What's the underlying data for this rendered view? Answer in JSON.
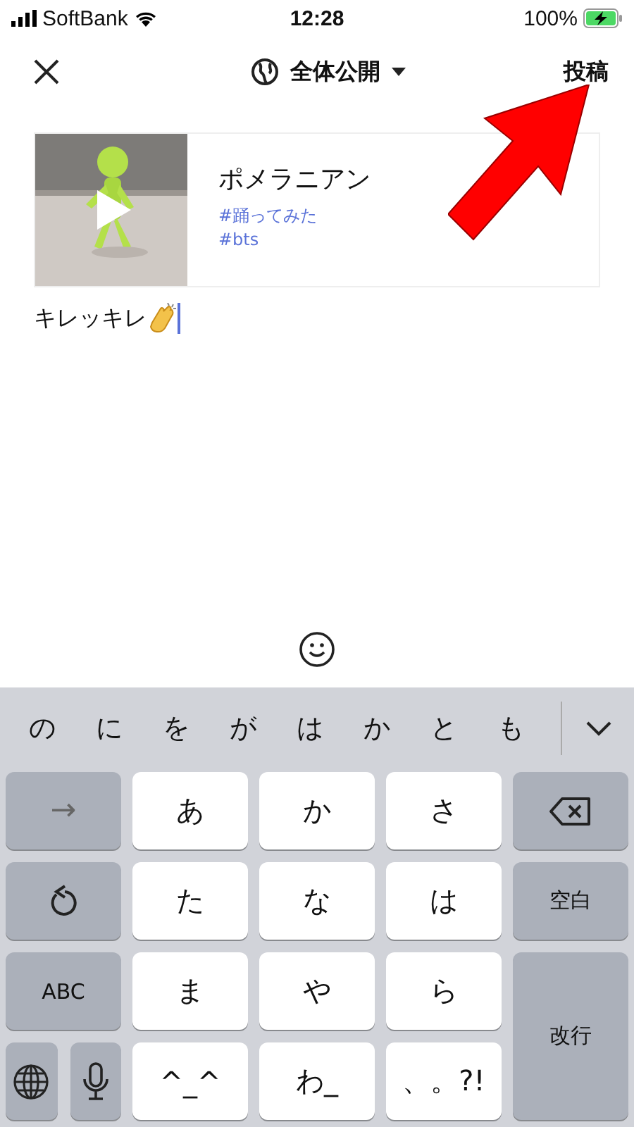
{
  "status_bar": {
    "carrier": "SoftBank",
    "time": "12:28",
    "battery": "100%"
  },
  "header": {
    "audience": "全体公開",
    "post": "投稿"
  },
  "video_card": {
    "title": "ポメラニアン",
    "tags": [
      "#踊ってみた",
      "#bts"
    ]
  },
  "comment": {
    "value": "キレッキレ"
  },
  "keyboard": {
    "candidates": [
      "の",
      "に",
      "を",
      "が",
      "は",
      "か",
      "と",
      "も"
    ],
    "keys": [
      {
        "label": "→",
        "kind": "function"
      },
      {
        "label": "あ",
        "kind": "letter"
      },
      {
        "label": "か",
        "kind": "letter"
      },
      {
        "label": "さ",
        "kind": "letter"
      },
      {
        "label": "た",
        "kind": "letter"
      },
      {
        "label": "な",
        "kind": "letter"
      },
      {
        "label": "は",
        "kind": "letter"
      },
      {
        "label": "空白",
        "kind": "function"
      },
      {
        "label": "ABC",
        "kind": "function"
      },
      {
        "label": "ま",
        "kind": "letter"
      },
      {
        "label": "や",
        "kind": "letter"
      },
      {
        "label": "ら",
        "kind": "letter"
      },
      {
        "label": "改行",
        "kind": "function"
      },
      {
        "label": "^_^",
        "kind": "letter"
      },
      {
        "label": "わ_",
        "kind": "letter"
      },
      {
        "label": "、。?!",
        "kind": "letter"
      }
    ]
  }
}
